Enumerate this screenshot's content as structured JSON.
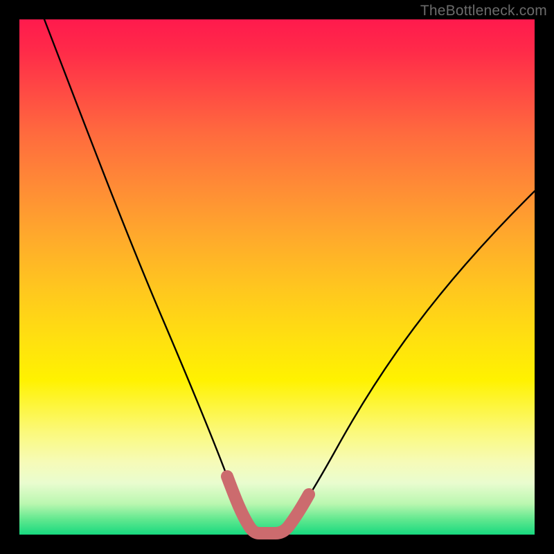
{
  "watermark": "TheBottleneck.com",
  "chart_data": {
    "type": "line",
    "title": "",
    "xlabel": "",
    "ylabel": "",
    "xlim": [
      0,
      100
    ],
    "ylim": [
      0,
      100
    ],
    "grid": false,
    "series": [
      {
        "name": "bottleneck-curve",
        "color": "#000000",
        "x": [
          0,
          5,
          10,
          15,
          20,
          25,
          30,
          34,
          36,
          38,
          40,
          42,
          44,
          46,
          48,
          50,
          55,
          60,
          65,
          70,
          75,
          80,
          85,
          90,
          95,
          100
        ],
        "values": [
          100,
          90,
          80,
          70,
          60,
          50,
          40,
          26,
          18,
          10,
          4,
          1,
          0,
          0,
          1,
          3,
          9,
          16,
          23,
          30,
          37,
          43,
          49,
          55,
          60,
          65
        ]
      },
      {
        "name": "highlight-band",
        "color": "#cc6b6e",
        "x": [
          38,
          40,
          42,
          44,
          46,
          48,
          50
        ],
        "values": [
          10,
          4,
          1,
          0,
          0,
          1,
          3
        ]
      }
    ],
    "gradient_stops": [
      {
        "pos": 0,
        "color": "#ff1a4d"
      },
      {
        "pos": 32,
        "color": "#ff8a36"
      },
      {
        "pos": 62,
        "color": "#ffe010"
      },
      {
        "pos": 86,
        "color": "#f6fbb8"
      },
      {
        "pos": 100,
        "color": "#17d97f"
      }
    ]
  }
}
